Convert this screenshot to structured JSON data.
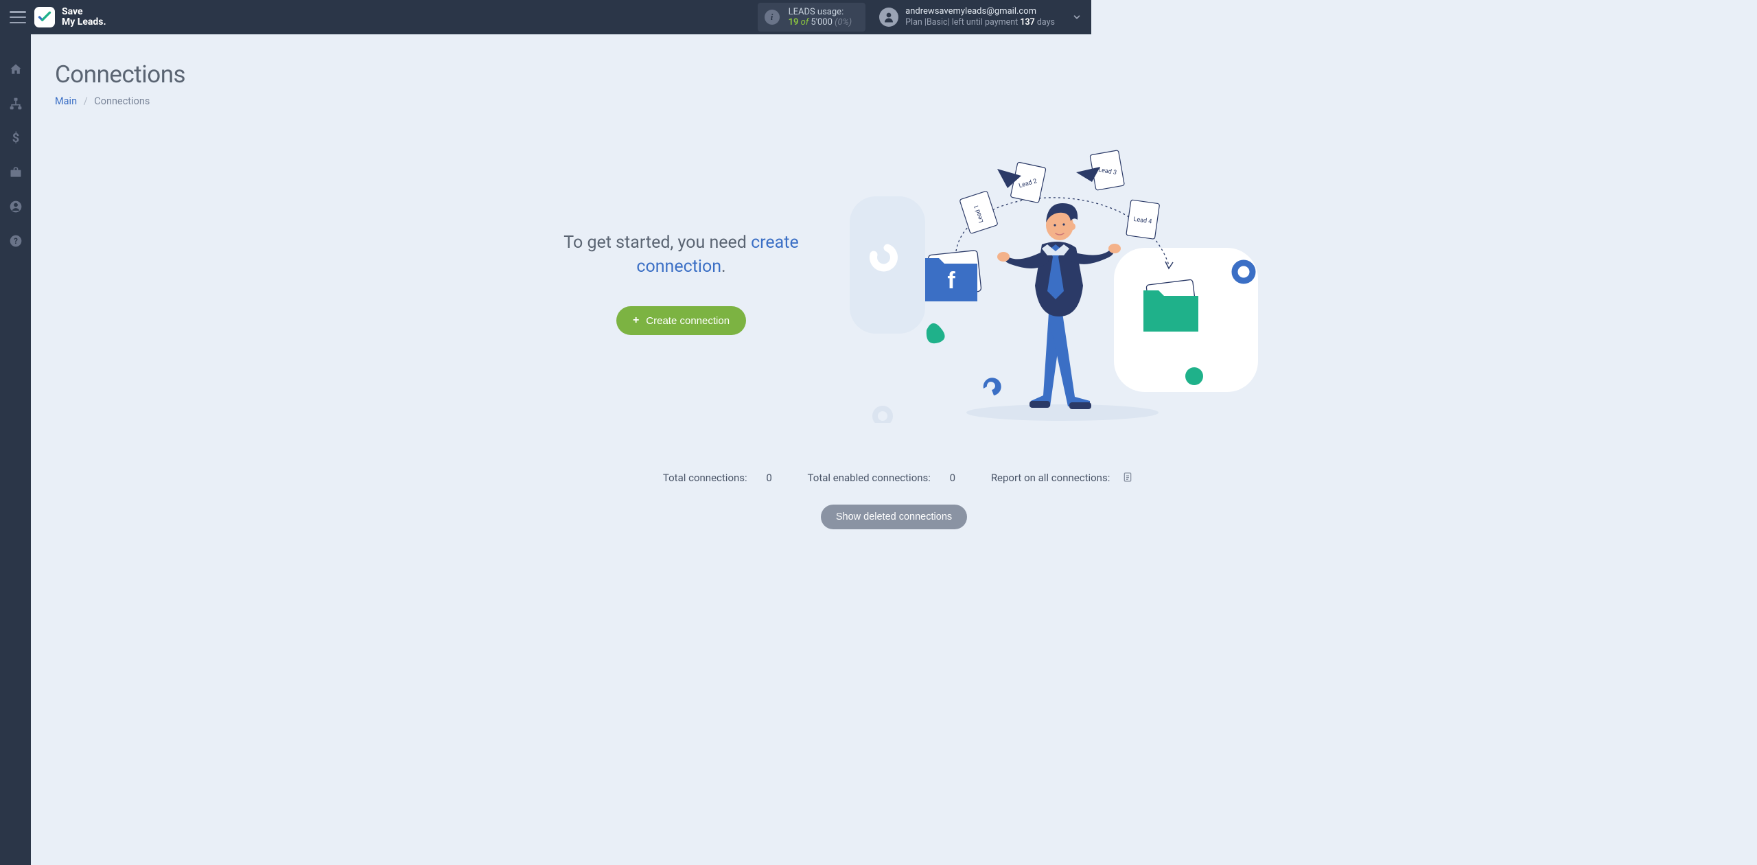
{
  "brand": {
    "line1": "Save",
    "line2": "My Leads."
  },
  "header": {
    "leads_label": "LEADS usage:",
    "leads_used": "19",
    "leads_of": " of ",
    "leads_total": "5'000",
    "leads_pct": "(0%)",
    "user_email": "andrewsavemyleads@gmail.com",
    "plan_prefix": "Plan |",
    "plan_name": "Basic",
    "plan_mid": "| left until payment ",
    "plan_days": "137",
    "plan_suffix": " days"
  },
  "sidebar": {
    "items": [
      "home",
      "connections",
      "billing",
      "briefcase",
      "account",
      "help"
    ]
  },
  "page": {
    "title": "Connections",
    "breadcrumb_main": "Main",
    "breadcrumb_current": "Connections"
  },
  "empty": {
    "msg_prefix": "To get started, you need ",
    "msg_link": "create connection",
    "msg_suffix": ".",
    "button_label": "Create connection"
  },
  "illustration": {
    "lead_labels": [
      "Lead 1",
      "Lead 2",
      "Lead 3",
      "Lead 4"
    ]
  },
  "stats": {
    "total_label": "Total connections: ",
    "total_value": "0",
    "enabled_label": "Total enabled connections: ",
    "enabled_value": "0",
    "report_label": "Report on all connections:"
  },
  "buttons": {
    "show_deleted": "Show deleted connections"
  }
}
